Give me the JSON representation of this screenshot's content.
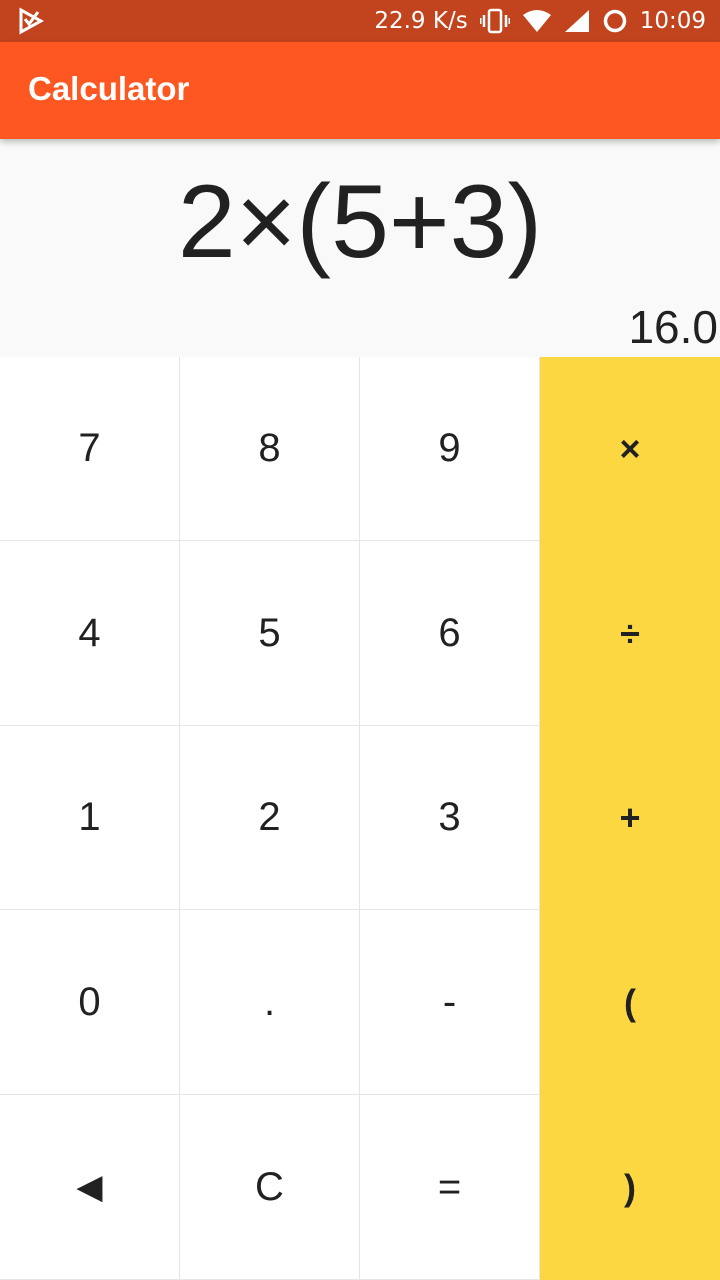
{
  "status_bar": {
    "network_speed": "22.9 K/s",
    "time": "10:09",
    "icons": [
      "app-notification-icon",
      "vibrate-icon",
      "wifi-icon",
      "signal-icon",
      "sync-icon"
    ]
  },
  "app_bar": {
    "title": "Calculator",
    "color": "#ff5722"
  },
  "display": {
    "expression": "2×(5+3)",
    "result": "16.0"
  },
  "keypad": {
    "operator_color": "#fdd741",
    "keys": [
      {
        "label": "7",
        "name": "key-7",
        "type": "digit"
      },
      {
        "label": "8",
        "name": "key-8",
        "type": "digit"
      },
      {
        "label": "9",
        "name": "key-9",
        "type": "digit"
      },
      {
        "label": "×",
        "name": "key-multiply",
        "type": "op"
      },
      {
        "label": "4",
        "name": "key-4",
        "type": "digit"
      },
      {
        "label": "5",
        "name": "key-5",
        "type": "digit"
      },
      {
        "label": "6",
        "name": "key-6",
        "type": "digit"
      },
      {
        "label": "÷",
        "name": "key-divide",
        "type": "op"
      },
      {
        "label": "1",
        "name": "key-1",
        "type": "digit"
      },
      {
        "label": "2",
        "name": "key-2",
        "type": "digit"
      },
      {
        "label": "3",
        "name": "key-3",
        "type": "digit"
      },
      {
        "label": "+",
        "name": "key-plus",
        "type": "op"
      },
      {
        "label": "0",
        "name": "key-0",
        "type": "digit"
      },
      {
        "label": ".",
        "name": "key-decimal",
        "type": "digit"
      },
      {
        "label": "-",
        "name": "key-minus",
        "type": "digit"
      },
      {
        "label": "(",
        "name": "key-open-paren",
        "type": "op"
      },
      {
        "label": "◀",
        "name": "key-backspace",
        "type": "back"
      },
      {
        "label": "C",
        "name": "key-clear",
        "type": "digit"
      },
      {
        "label": "=",
        "name": "key-equals",
        "type": "digit"
      },
      {
        "label": ")",
        "name": "key-close-paren",
        "type": "op"
      }
    ]
  }
}
